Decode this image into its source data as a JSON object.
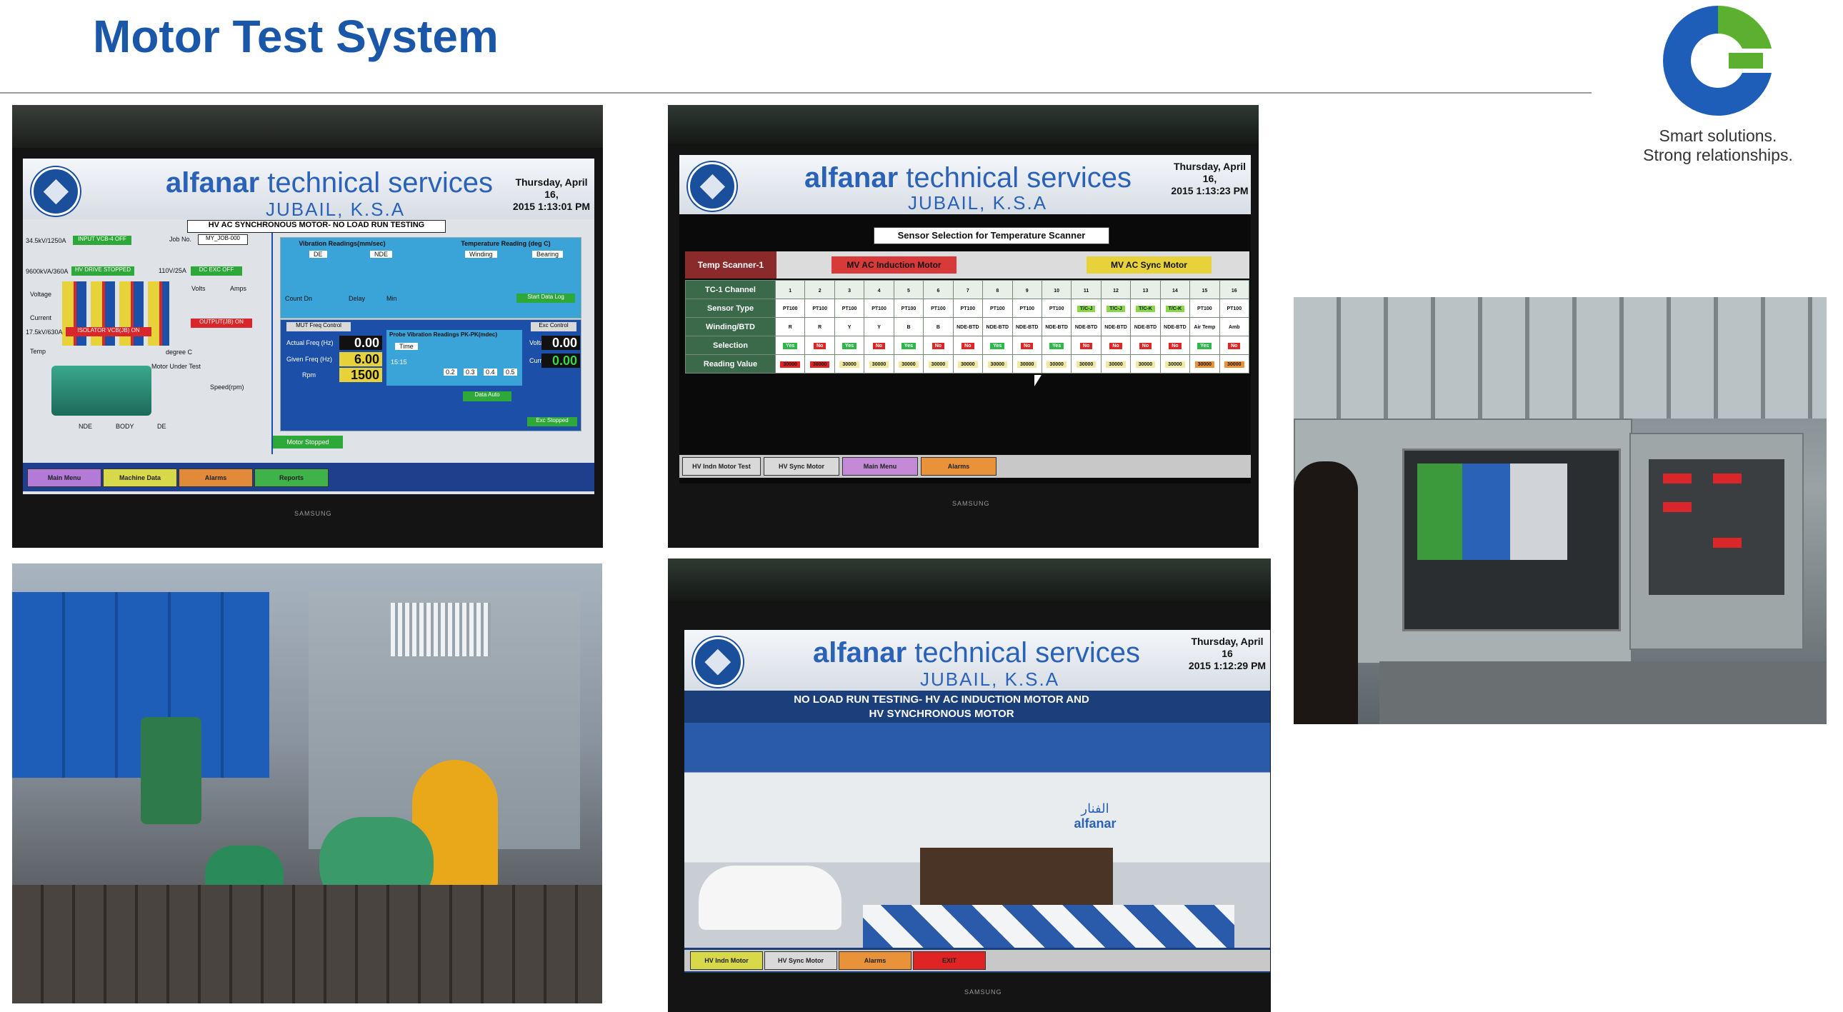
{
  "slide": {
    "title": "Motor Test System",
    "tagline_line1": "Smart solutions.",
    "tagline_line2": "Strong relationships.",
    "accent_color": "#1b57a8"
  },
  "hmi_common": {
    "brand_bold": "alfanar",
    "brand_rest": "technical services",
    "city": "JUBAIL, K.S.A",
    "bezel": "SAMSUNG"
  },
  "screen1": {
    "date_line1": "Thursday, April 16,",
    "date_line2": "2015 1:13:01 PM",
    "heading": "HV AC SYNCHRONOUS MOTOR- NO LOAD RUN TESTING",
    "job_label": "Job No.",
    "job_value": "MY_JOB-000",
    "input_vcb": "INPUT VCB-4 OFF",
    "hv_drive": "HV DRIVE STOPPED",
    "dc_exc": "DC EXC OFF",
    "isolator": "ISOLATOR VCB(JB) ON",
    "output": "OUTPUT(JB) ON",
    "rating1": "34.5kV/1250A",
    "rating2": "9600kVA/360A",
    "rating3": "17.5kV/630A",
    "rating4": "110V/25A",
    "voltage_label": "Voltage",
    "current_label": "Current",
    "temp_label": "Temp",
    "volts_label": "Volts",
    "amps_label": "Amps",
    "vibration_panel": "Vibration Readings(mm/sec)",
    "temperature_panel": "Temperature Reading (deg C)",
    "de": "DE",
    "nde": "NDE",
    "winding": "Winding",
    "bearing": "Bearing",
    "count_dn": "Count Dn",
    "delay": "Delay",
    "min": "Min",
    "start_data_log": "Start Data Log",
    "mut_freq": "MUT Freq Control",
    "exc_control": "Exc Control",
    "actual_freq": "Actual Freq (Hz)",
    "actual_freq_value": "0.00",
    "given_freq": "Given Freq (Hz)",
    "given_freq_value": "6.00",
    "rpm_label": "Rpm",
    "rpm_value": "1500",
    "voltage_value": "0.00",
    "current_value": "0.00",
    "probe_title": "Probe Vibration Readings PK-PK(mdec)",
    "time_label": "Time",
    "time_value": "15:15",
    "probe_vals": [
      "0.2",
      "0.3",
      "0.4",
      "0.5"
    ],
    "data_auto": "Data Auto",
    "exc_stopped": "Exc Stopped",
    "motor_stopped": "Motor Stopped",
    "speed_label": "Speed(rpm)",
    "motor_under_test": "Motor Under Test",
    "body": "BODY",
    "degree_c": "degree C",
    "nav": [
      "Main Menu",
      "Machine Data",
      "Alarms",
      "Reports"
    ],
    "nav_colors": [
      "#b47ad8",
      "#d7d84a",
      "#e08a3a",
      "#3fb24a"
    ]
  },
  "screen2": {
    "date_line1": "Thursday, April 16,",
    "date_line2": "2015 1:13:23 PM",
    "scanner_title": "Sensor Selection for Temperature Scanner",
    "temp_scanner": "Temp Scanner-1",
    "mv_induction": "MV AC Induction Motor",
    "mv_sync": "MV AC Sync Motor",
    "row_labels": [
      "TC-1 Channel",
      "Sensor Type",
      "Winding/BTD",
      "Selection",
      "Reading Value"
    ],
    "channels": [
      "1",
      "2",
      "3",
      "4",
      "5",
      "6",
      "7",
      "8",
      "9",
      "10",
      "11",
      "12",
      "13",
      "14",
      "15",
      "16"
    ],
    "sensor_types": [
      "PT100",
      "PT100",
      "PT100",
      "PT100",
      "PT100",
      "PT100",
      "PT100",
      "PT100",
      "PT100",
      "PT100",
      "T/C-J",
      "T/C-J",
      "T/C-K",
      "T/C-K",
      "PT100",
      "PT100"
    ],
    "winding": [
      "R",
      "R",
      "Y",
      "Y",
      "B",
      "B",
      "NDE-BTD",
      "NDE-BTD",
      "NDE-BTD",
      "NDE-BTD",
      "NDE-BTD",
      "NDE-BTD",
      "NDE-BTD",
      "NDE-BTD",
      "Air Temp",
      "Amb"
    ],
    "selection": [
      "Yes",
      "No",
      "Yes",
      "No",
      "Yes",
      "No",
      "No",
      "Yes",
      "No",
      "Yes",
      "No",
      "No",
      "No",
      "No",
      "Yes",
      "No"
    ],
    "readings": [
      "30000",
      "30000",
      "30000",
      "30000",
      "30000",
      "30000",
      "30000",
      "30000",
      "30000",
      "30000",
      "30000",
      "30000",
      "30000",
      "30000",
      "30000",
      "30000"
    ],
    "nav": [
      "HV Indn Motor Test",
      "HV Sync Motor",
      "Main Menu",
      "Alarms"
    ],
    "nav_colors": [
      "#d9d9d9",
      "#d9d9d9",
      "#c48ad8",
      "#e8923a"
    ]
  },
  "screen3": {
    "date_line1": "Thursday, April 16",
    "date_line2": "2015 1:12:29 PM",
    "heading_line1": "NO LOAD RUN TESTING- HV AC INDUCTION MOTOR AND",
    "heading_line2": "HV SYNCHRONOUS MOTOR",
    "lobby_sign_arabic": "الفنار",
    "lobby_sign_latin": "alfanar",
    "nav": [
      "HV Indn Motor",
      "HV Sync Motor",
      "Alarms",
      "EXIT"
    ],
    "nav_colors": [
      "#d7d84a",
      "#d9d9d9",
      "#e8923a",
      "#e02424"
    ]
  }
}
